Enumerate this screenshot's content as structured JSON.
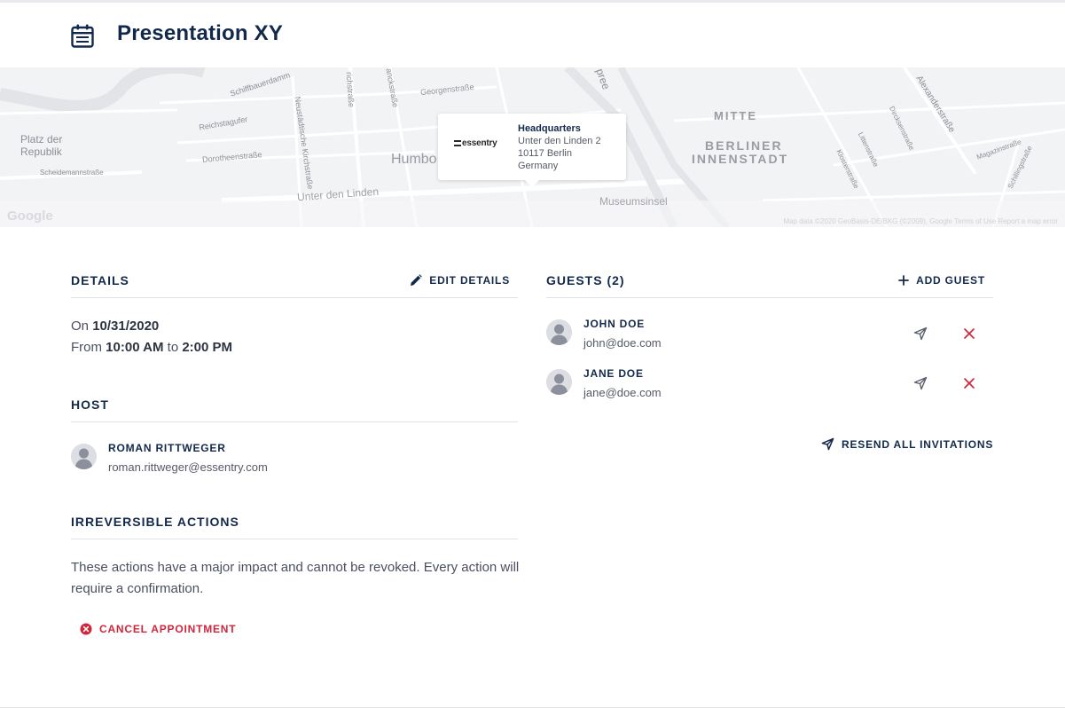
{
  "header": {
    "title": "Presentation XY",
    "icon": "calendar-icon"
  },
  "map": {
    "popup": {
      "logo_text": "essentry",
      "name": "Headquarters",
      "address_line1": "Unter den Linden 2",
      "address_line2": "10117 Berlin",
      "address_line3": "Germany"
    },
    "labels": {
      "platz_line1": "Platz der",
      "platz_line2": "Republik",
      "scheidemann": "Scheidemannstraße",
      "schiffbauerdamm": "Schiffbauerdamm",
      "reichstagufer": "Reichstagufer",
      "dorotheen": "Dorotheenstraße",
      "neustaedtische": "Neustädtische Kirchstraße",
      "friedrich": "richstraße",
      "planck": "anckstraße",
      "georgen": "Georgenstraße",
      "spree": "pree",
      "humbo": "Humbo",
      "unter_den_linden": "Unter den Linden",
      "museumsinsel": "Museumsinsel",
      "mitte": "MITTE",
      "berliner": "BERLINER",
      "innenstadt": "INNENSTADT",
      "alexander": "Alexanderstraße",
      "dircksen": "Dircksenstraße",
      "litten": "Littenstraße",
      "kloster": "Klosterstraße",
      "magazin": "Magazinstraße",
      "schilling": "Schillingstraße",
      "google": "Google",
      "map_data": "Map data ©2020 GeoBasis-DE/BKG (©2009), Google    Terms of Use    Report a map error"
    }
  },
  "details": {
    "title": "DETAILS",
    "edit_label": "EDIT DETAILS",
    "on_prefix": "On",
    "date": "10/31/2020",
    "from_prefix": "From",
    "start_time": "10:00 AM",
    "to_word": "to",
    "end_time": "2:00 PM"
  },
  "host": {
    "title": "HOST",
    "name": "ROMAN RITTWEGER",
    "email": "roman.rittweger@essentry.com"
  },
  "irreversible": {
    "title": "IRREVERSIBLE ACTIONS",
    "description": "These actions have a major impact and cannot be revoked. Every action will require a confirmation.",
    "cancel_label": "CANCEL APPOINTMENT"
  },
  "guests": {
    "title": "GUESTS (2)",
    "add_label": "ADD GUEST",
    "resend_label": "RESEND ALL INVITATIONS",
    "list": [
      {
        "name": "JOHN DOE",
        "email": "john@doe.com"
      },
      {
        "name": "JANE DOE",
        "email": "jane@doe.com"
      }
    ]
  },
  "colors": {
    "navy": "#13294b",
    "danger": "#d0263c",
    "divider": "#e0e2e7"
  }
}
